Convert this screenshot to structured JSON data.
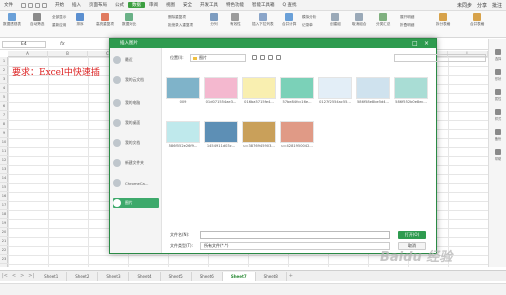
{
  "menubar": {
    "items": [
      "文件",
      "开始",
      "插入",
      "页面布局",
      "公式",
      "数据",
      "审阅",
      "视图",
      "安全",
      "开发工具",
      "特色功能",
      "智能工具箱",
      "Q 查找"
    ],
    "active_index": 5,
    "right": [
      "未同步",
      "分享",
      "批注"
    ]
  },
  "ribbon": {
    "buttons": [
      "数据透视表",
      "自动筛选",
      "全部显示",
      "重新应用",
      "排序",
      "高亮重复项",
      "数据对比",
      "删除重复项",
      "拒绝录入重复项",
      "分列",
      "有效性",
      "插入下拉列表",
      "合并计算",
      "模拟分析",
      "记录单",
      "创建组",
      "取消组合",
      "分类汇总",
      "展开明细",
      "折叠明细",
      "拆分表格",
      "合并表格"
    ]
  },
  "formula": {
    "cell": "E4",
    "fx": "fx"
  },
  "sheet": {
    "columns": [
      "A",
      "B",
      "C",
      "D",
      "E",
      "F",
      "G",
      "H",
      "I",
      "J",
      "K",
      "L"
    ],
    "rows": [
      "1",
      "2",
      "3",
      "4",
      "5",
      "6",
      "7",
      "8",
      "9",
      "10",
      "11",
      "12",
      "13",
      "14",
      "15",
      "16",
      "17",
      "18",
      "19",
      "20",
      "21",
      "22",
      "23"
    ],
    "a1": "要求：Excel中快速插"
  },
  "right_pane": [
    "选择",
    "形状",
    "属性",
    "样式",
    "备份",
    "帮助"
  ],
  "tabs": {
    "items": [
      "Sheet1",
      "Sheet2",
      "Sheet3",
      "Sheet4",
      "Sheet5",
      "Sheet6",
      "Sheet7",
      "Sheet8"
    ],
    "active_index": 6,
    "add": "+"
  },
  "dialog": {
    "title": "插入图片",
    "nav": [
      "最近",
      "我的云文档",
      "我的电脑",
      "我的桌面",
      "我的文档",
      "新建文件夹",
      "ChromeCa...",
      "图片"
    ],
    "nav_selected": 7,
    "location_label": "位置(I):",
    "location_value": "图片",
    "files": [
      {
        "name": "009",
        "color": "#7fb3c9"
      },
      {
        "name": "01d071554ae3...",
        "color": "#f4b8cf"
      },
      {
        "name": "016ba5715fe4...",
        "color": "#f9efb0"
      },
      {
        "name": "57be84fcc16e...",
        "color": "#7bd1b8"
      },
      {
        "name": "0127f2554ac55...",
        "color": "#e3eef7"
      },
      {
        "name": "586f58e8be5d4...",
        "color": "#cfe2ee"
      },
      {
        "name": "586f552b0e8ec...",
        "color": "#a9ddd5"
      },
      {
        "name": "586f552e26f9...",
        "color": "#bfe9ec"
      },
      {
        "name": "1454911d03c...",
        "color": "#5d8fb5"
      },
      {
        "name": "u=3876945903...",
        "color": "#c9a05a"
      },
      {
        "name": "u=4281950042...",
        "color": "#e09a86"
      }
    ],
    "filename_label": "文件名(N):",
    "filename_value": "",
    "filetype_label": "文件类型(T):",
    "filetype_value": "所有文件(*.*)",
    "open": "打开(O)",
    "cancel": "取消"
  },
  "watermark": "Baidu 经验",
  "colors": {
    "accent": "#2e9b4f",
    "a1_text": "#dd2222"
  }
}
